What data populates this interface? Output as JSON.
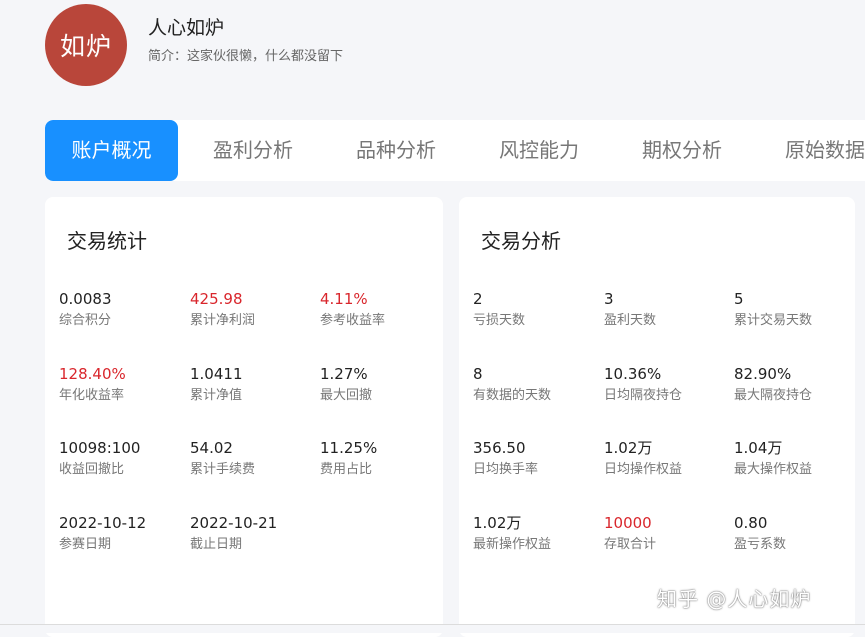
{
  "profile": {
    "avatar_text": "如炉",
    "name": "人心如炉",
    "bio": "简介：这家伙很懒，什么都没留下"
  },
  "tabs": [
    {
      "label": "账户概况",
      "active": true
    },
    {
      "label": "盈利分析",
      "active": false
    },
    {
      "label": "品种分析",
      "active": false
    },
    {
      "label": "风控能力",
      "active": false
    },
    {
      "label": "期权分析",
      "active": false
    },
    {
      "label": "原始数据",
      "active": false
    }
  ],
  "colors": {
    "accent": "#1890ff",
    "avatar_bg": "#b9463a",
    "highlight_red": "#d9262c"
  },
  "trade_stats": {
    "title": "交易统计",
    "items": [
      {
        "value": "0.0083",
        "label": "综合积分",
        "highlight": false
      },
      {
        "value": "425.98",
        "label": "累计净利润",
        "highlight": true
      },
      {
        "value": "4.11%",
        "label": "参考收益率",
        "highlight": true
      },
      {
        "value": "128.40%",
        "label": "年化收益率",
        "highlight": true
      },
      {
        "value": "1.0411",
        "label": "累计净值",
        "highlight": false
      },
      {
        "value": "1.27%",
        "label": "最大回撤",
        "highlight": false
      },
      {
        "value": "10098:100",
        "label": "收益回撤比",
        "highlight": false
      },
      {
        "value": "54.02",
        "label": "累计手续费",
        "highlight": false
      },
      {
        "value": "11.25%",
        "label": "费用占比",
        "highlight": false
      },
      {
        "value": "2022-10-12",
        "label": "参赛日期",
        "highlight": false
      },
      {
        "value": "2022-10-21",
        "label": "截止日期",
        "highlight": false
      }
    ]
  },
  "trade_analysis": {
    "title": "交易分析",
    "items": [
      {
        "value": "2",
        "label": "亏损天数",
        "highlight": false
      },
      {
        "value": "3",
        "label": "盈利天数",
        "highlight": false
      },
      {
        "value": "5",
        "label": "累计交易天数",
        "highlight": false
      },
      {
        "value": "8",
        "label": "有数据的天数",
        "highlight": false
      },
      {
        "value": "10.36%",
        "label": "日均隔夜持仓",
        "highlight": false
      },
      {
        "value": "82.90%",
        "label": "最大隔夜持仓",
        "highlight": false
      },
      {
        "value": "356.50",
        "label": "日均换手率",
        "highlight": false
      },
      {
        "value": "1.02万",
        "label": "日均操作权益",
        "highlight": false
      },
      {
        "value": "1.04万",
        "label": "最大操作权益",
        "highlight": false
      },
      {
        "value": "1.02万",
        "label": "最新操作权益",
        "highlight": false
      },
      {
        "value": "10000",
        "label": "存取合计",
        "highlight": true
      },
      {
        "value": "0.80",
        "label": "盈亏系数",
        "highlight": false
      }
    ]
  },
  "watermark": "知乎 @人心如炉"
}
